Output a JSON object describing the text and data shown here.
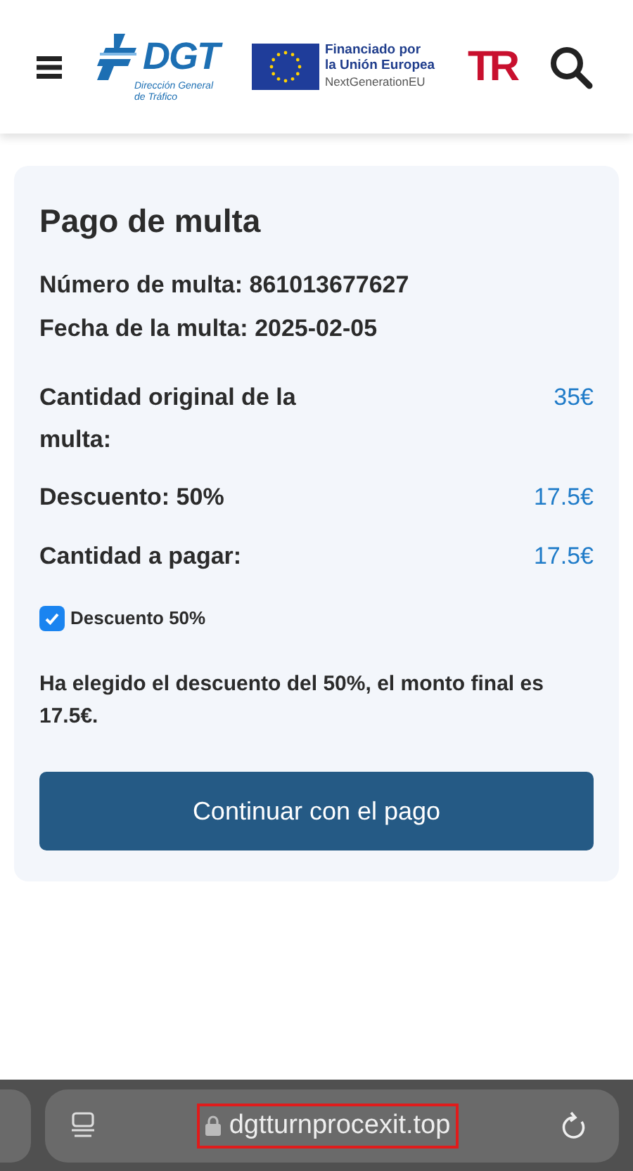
{
  "header": {
    "dgt_logo": {
      "mark": "DGT",
      "subtitle": "Dirección General de Tráfico"
    },
    "eu_logo": {
      "line_1": "Financiado por",
      "line_2": "la Unión Europea",
      "line_3": "NextGenerationEU"
    },
    "tr_logo": "TR"
  },
  "card": {
    "title": "Pago de multa",
    "details": [
      {
        "label": "Número de multa:",
        "value": "861013677627"
      },
      {
        "label": "Fecha de la multa:",
        "value": "2025-02-05"
      }
    ],
    "amounts": [
      {
        "label": "Cantidad original de la multa:",
        "value": "35€"
      },
      {
        "label": "Descuento: 50%",
        "value": "17.5€"
      },
      {
        "label": "Cantidad a pagar:",
        "value": "17.5€"
      }
    ],
    "discount_checkbox": {
      "label": "Descuento 50%",
      "checked": true
    },
    "message": "Ha elegido el descuento del 50%, el monto final es 17.5€.",
    "button": "Continuar con el pago"
  },
  "browser_bar": {
    "url": "dgtturnprocexit.top",
    "url_highlighted": true
  }
}
